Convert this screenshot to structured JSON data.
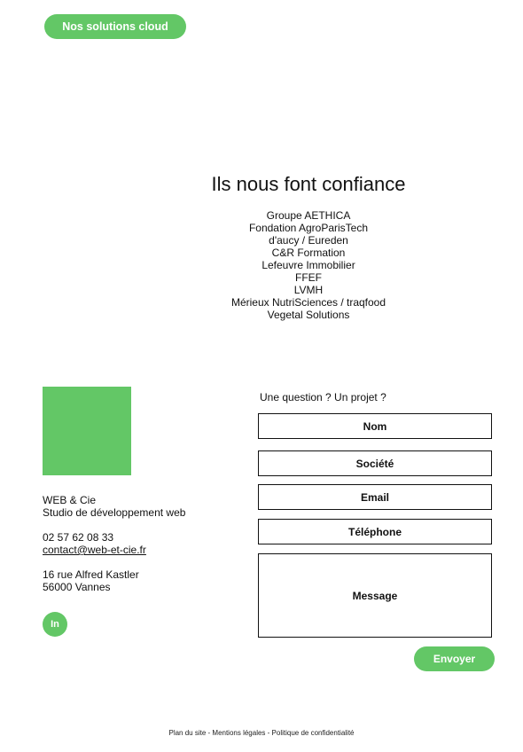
{
  "header": {
    "cta_label": "Nos solutions cloud"
  },
  "trust": {
    "title": "Ils nous font confiance",
    "clients": [
      "Groupe AETHICA",
      "Fondation AgroParisTech",
      "d'aucy / Eureden",
      "C&R Formation",
      "Lefeuvre Immobilier",
      "FFEF",
      "LVMH",
      "Mérieux NutriSciences / traqfood",
      "Vegetal Solutions"
    ]
  },
  "company": {
    "name": "WEB & Cie",
    "tagline": "Studio de développement web",
    "phone": "02 57 62 08 33",
    "email": "contact@web-et-cie.fr",
    "address_line1": "16 rue Alfred Kastler",
    "address_line2": "56000 Vannes",
    "social_label": "In"
  },
  "form": {
    "title": "Une question ? Un projet ?",
    "nom": "Nom",
    "societe": "Société",
    "email": "Email",
    "telephone": "Téléphone",
    "message": "Message",
    "submit": "Envoyer"
  },
  "footer": {
    "text": "Plan du site - Mentions légales - Politique de confidentialité"
  },
  "colors": {
    "accent": "#63c766"
  }
}
